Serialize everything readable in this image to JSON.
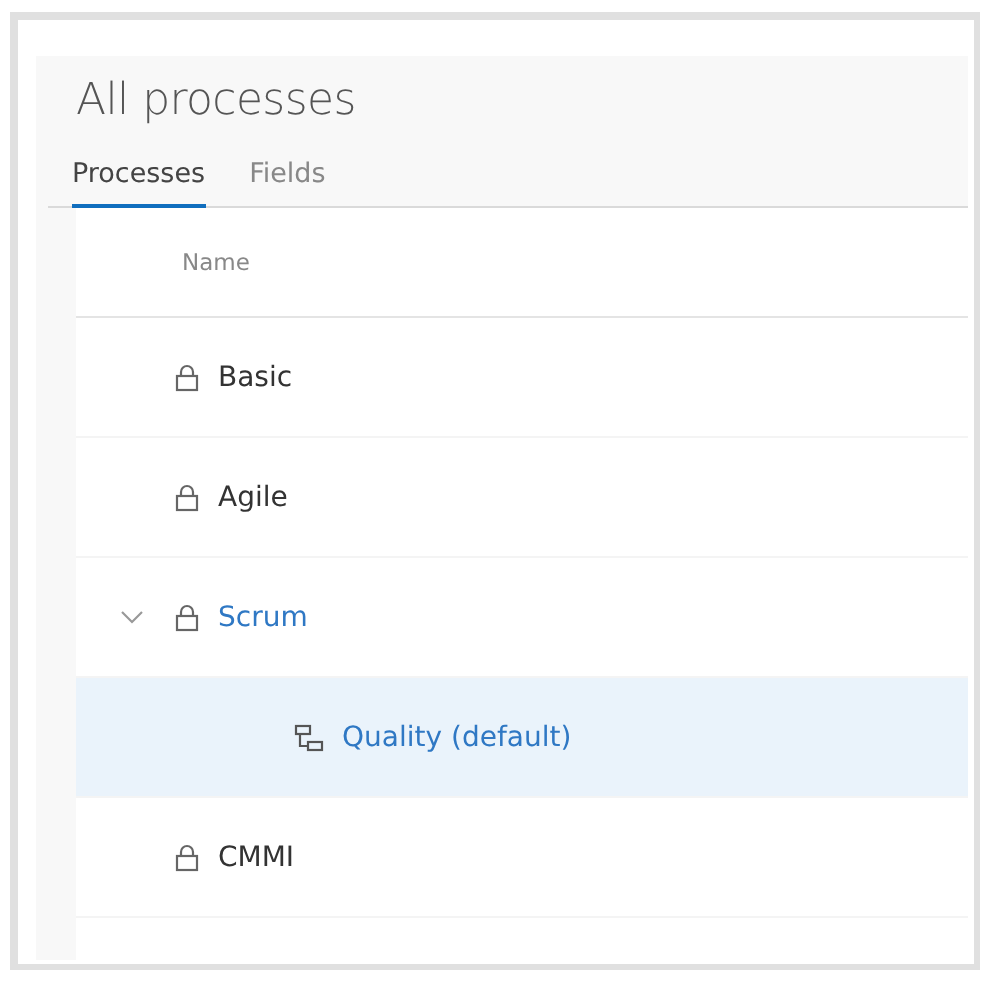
{
  "page": {
    "title": "All processes"
  },
  "tabs": [
    {
      "label": "Processes",
      "selected": true
    },
    {
      "label": "Fields",
      "selected": false
    }
  ],
  "table": {
    "columns": [
      "Name"
    ],
    "rows": [
      {
        "name": "Basic",
        "kind": "locked",
        "selected": false
      },
      {
        "name": "Agile",
        "kind": "locked",
        "selected": false
      },
      {
        "name": "Scrum",
        "kind": "locked",
        "selected": false,
        "expanded": true,
        "children": [
          {
            "name": "Quality (default)",
            "kind": "inherited",
            "selected": true
          }
        ]
      },
      {
        "name": "CMMI",
        "kind": "locked",
        "selected": false
      }
    ]
  }
}
